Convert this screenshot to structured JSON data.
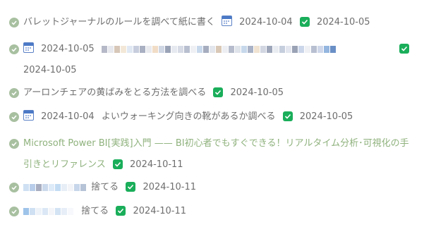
{
  "tasks": [
    {
      "text": "バレットジャーナルのルールを調べて紙に書く",
      "start_date": "2024-10-04",
      "done_date": "2024-10-05"
    },
    {
      "start_date": "2024-10-05",
      "done_date": "2024-10-05"
    },
    {
      "text": "アーロンチェアの黄ばみをとる方法を調べる",
      "done_date": "2024-10-05"
    },
    {
      "start_date": "2024-10-04",
      "text": "よいウォーキング向きの靴があるか調べる",
      "done_date": "2024-10-05"
    },
    {
      "link_text_line1": "Microsoft Power BI[実践]入門 —— BI初心者でもすぐできる！リアルタイム分析･可視化の手",
      "link_text_line2": "引きとリファレンス",
      "done_date": "2024-10-11"
    },
    {
      "text": "捨てる",
      "done_date": "2024-10-11"
    },
    {
      "text": "捨てる",
      "done_date": "2024-10-11"
    }
  ]
}
